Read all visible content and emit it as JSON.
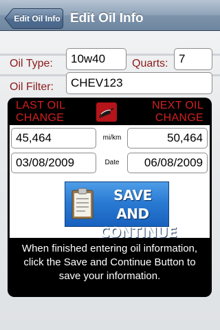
{
  "navbar": {
    "back_label": "Edit Oil Info",
    "title": "Edit Oil Info"
  },
  "form": {
    "oil_type_label": "Oil Type:",
    "oil_type_value": "10w40",
    "quarts_label": "Quarts:",
    "quarts_value": "7",
    "oil_filter_label": "Oil Filter:",
    "oil_filter_value": "CHEV123"
  },
  "panel": {
    "last_header": "Last Oil Change",
    "next_header": "Next Oil Change",
    "last_mileage": "45,464",
    "next_mileage": "50,464",
    "mileage_unit": "mi/km",
    "last_date": "03/08/2009",
    "next_date": "06/08/2009",
    "date_label": "Date",
    "save_button_line1": "SAVE AND",
    "save_button_line2": "CONTINUE",
    "info_text": "When finished entering oil information, click the Save and Continue Button to save your information."
  },
  "colors": {
    "label_red": "#8b1a1a",
    "header_red": "#d41f1f",
    "button_blue": "#2a7bd3",
    "navbar_blue": "#7d93ab"
  },
  "icons": {
    "oil_can": "oil-can-icon",
    "clipboard": "clipboard-icon",
    "back_arrow": "back-arrow-shape"
  }
}
